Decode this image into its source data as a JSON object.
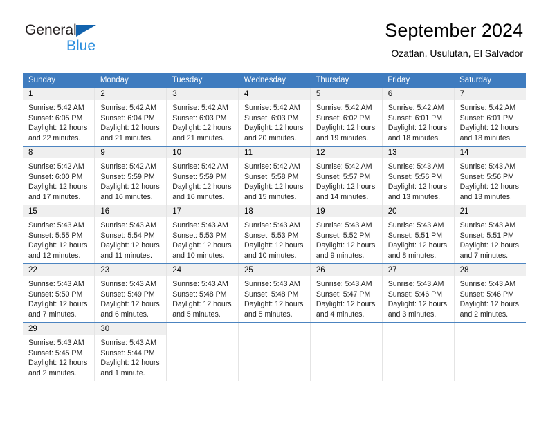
{
  "logo": {
    "word_one": "General",
    "word_two": "Blue",
    "sail_icon": "sail-triangle-icon",
    "colors": {
      "dark": "#231f20",
      "blue": "#2b8ede",
      "sail": "#1263ae"
    }
  },
  "header": {
    "title": "September 2024",
    "subtitle": "Ozatlan, Usulutan, El Salvador"
  },
  "theme": {
    "header_blue": "#3f7cbf",
    "row_divider": "#4c84c0",
    "daynum_bg": "#efefef",
    "cell_divider": "#e4e4e4"
  },
  "calendar": {
    "weekday_headers": [
      "Sunday",
      "Monday",
      "Tuesday",
      "Wednesday",
      "Thursday",
      "Friday",
      "Saturday"
    ],
    "weeks": [
      [
        {
          "day": "1",
          "sunrise": "Sunrise: 5:42 AM",
          "sunset": "Sunset: 6:05 PM",
          "daylight_line1": "Daylight: 12 hours",
          "daylight_line2": "and 22 minutes."
        },
        {
          "day": "2",
          "sunrise": "Sunrise: 5:42 AM",
          "sunset": "Sunset: 6:04 PM",
          "daylight_line1": "Daylight: 12 hours",
          "daylight_line2": "and 21 minutes."
        },
        {
          "day": "3",
          "sunrise": "Sunrise: 5:42 AM",
          "sunset": "Sunset: 6:03 PM",
          "daylight_line1": "Daylight: 12 hours",
          "daylight_line2": "and 21 minutes."
        },
        {
          "day": "4",
          "sunrise": "Sunrise: 5:42 AM",
          "sunset": "Sunset: 6:03 PM",
          "daylight_line1": "Daylight: 12 hours",
          "daylight_line2": "and 20 minutes."
        },
        {
          "day": "5",
          "sunrise": "Sunrise: 5:42 AM",
          "sunset": "Sunset: 6:02 PM",
          "daylight_line1": "Daylight: 12 hours",
          "daylight_line2": "and 19 minutes."
        },
        {
          "day": "6",
          "sunrise": "Sunrise: 5:42 AM",
          "sunset": "Sunset: 6:01 PM",
          "daylight_line1": "Daylight: 12 hours",
          "daylight_line2": "and 18 minutes."
        },
        {
          "day": "7",
          "sunrise": "Sunrise: 5:42 AM",
          "sunset": "Sunset: 6:01 PM",
          "daylight_line1": "Daylight: 12 hours",
          "daylight_line2": "and 18 minutes."
        }
      ],
      [
        {
          "day": "8",
          "sunrise": "Sunrise: 5:42 AM",
          "sunset": "Sunset: 6:00 PM",
          "daylight_line1": "Daylight: 12 hours",
          "daylight_line2": "and 17 minutes."
        },
        {
          "day": "9",
          "sunrise": "Sunrise: 5:42 AM",
          "sunset": "Sunset: 5:59 PM",
          "daylight_line1": "Daylight: 12 hours",
          "daylight_line2": "and 16 minutes."
        },
        {
          "day": "10",
          "sunrise": "Sunrise: 5:42 AM",
          "sunset": "Sunset: 5:59 PM",
          "daylight_line1": "Daylight: 12 hours",
          "daylight_line2": "and 16 minutes."
        },
        {
          "day": "11",
          "sunrise": "Sunrise: 5:42 AM",
          "sunset": "Sunset: 5:58 PM",
          "daylight_line1": "Daylight: 12 hours",
          "daylight_line2": "and 15 minutes."
        },
        {
          "day": "12",
          "sunrise": "Sunrise: 5:42 AM",
          "sunset": "Sunset: 5:57 PM",
          "daylight_line1": "Daylight: 12 hours",
          "daylight_line2": "and 14 minutes."
        },
        {
          "day": "13",
          "sunrise": "Sunrise: 5:43 AM",
          "sunset": "Sunset: 5:56 PM",
          "daylight_line1": "Daylight: 12 hours",
          "daylight_line2": "and 13 minutes."
        },
        {
          "day": "14",
          "sunrise": "Sunrise: 5:43 AM",
          "sunset": "Sunset: 5:56 PM",
          "daylight_line1": "Daylight: 12 hours",
          "daylight_line2": "and 13 minutes."
        }
      ],
      [
        {
          "day": "15",
          "sunrise": "Sunrise: 5:43 AM",
          "sunset": "Sunset: 5:55 PM",
          "daylight_line1": "Daylight: 12 hours",
          "daylight_line2": "and 12 minutes."
        },
        {
          "day": "16",
          "sunrise": "Sunrise: 5:43 AM",
          "sunset": "Sunset: 5:54 PM",
          "daylight_line1": "Daylight: 12 hours",
          "daylight_line2": "and 11 minutes."
        },
        {
          "day": "17",
          "sunrise": "Sunrise: 5:43 AM",
          "sunset": "Sunset: 5:53 PM",
          "daylight_line1": "Daylight: 12 hours",
          "daylight_line2": "and 10 minutes."
        },
        {
          "day": "18",
          "sunrise": "Sunrise: 5:43 AM",
          "sunset": "Sunset: 5:53 PM",
          "daylight_line1": "Daylight: 12 hours",
          "daylight_line2": "and 10 minutes."
        },
        {
          "day": "19",
          "sunrise": "Sunrise: 5:43 AM",
          "sunset": "Sunset: 5:52 PM",
          "daylight_line1": "Daylight: 12 hours",
          "daylight_line2": "and 9 minutes."
        },
        {
          "day": "20",
          "sunrise": "Sunrise: 5:43 AM",
          "sunset": "Sunset: 5:51 PM",
          "daylight_line1": "Daylight: 12 hours",
          "daylight_line2": "and 8 minutes."
        },
        {
          "day": "21",
          "sunrise": "Sunrise: 5:43 AM",
          "sunset": "Sunset: 5:51 PM",
          "daylight_line1": "Daylight: 12 hours",
          "daylight_line2": "and 7 minutes."
        }
      ],
      [
        {
          "day": "22",
          "sunrise": "Sunrise: 5:43 AM",
          "sunset": "Sunset: 5:50 PM",
          "daylight_line1": "Daylight: 12 hours",
          "daylight_line2": "and 7 minutes."
        },
        {
          "day": "23",
          "sunrise": "Sunrise: 5:43 AM",
          "sunset": "Sunset: 5:49 PM",
          "daylight_line1": "Daylight: 12 hours",
          "daylight_line2": "and 6 minutes."
        },
        {
          "day": "24",
          "sunrise": "Sunrise: 5:43 AM",
          "sunset": "Sunset: 5:48 PM",
          "daylight_line1": "Daylight: 12 hours",
          "daylight_line2": "and 5 minutes."
        },
        {
          "day": "25",
          "sunrise": "Sunrise: 5:43 AM",
          "sunset": "Sunset: 5:48 PM",
          "daylight_line1": "Daylight: 12 hours",
          "daylight_line2": "and 5 minutes."
        },
        {
          "day": "26",
          "sunrise": "Sunrise: 5:43 AM",
          "sunset": "Sunset: 5:47 PM",
          "daylight_line1": "Daylight: 12 hours",
          "daylight_line2": "and 4 minutes."
        },
        {
          "day": "27",
          "sunrise": "Sunrise: 5:43 AM",
          "sunset": "Sunset: 5:46 PM",
          "daylight_line1": "Daylight: 12 hours",
          "daylight_line2": "and 3 minutes."
        },
        {
          "day": "28",
          "sunrise": "Sunrise: 5:43 AM",
          "sunset": "Sunset: 5:46 PM",
          "daylight_line1": "Daylight: 12 hours",
          "daylight_line2": "and 2 minutes."
        }
      ],
      [
        {
          "day": "29",
          "sunrise": "Sunrise: 5:43 AM",
          "sunset": "Sunset: 5:45 PM",
          "daylight_line1": "Daylight: 12 hours",
          "daylight_line2": "and 2 minutes."
        },
        {
          "day": "30",
          "sunrise": "Sunrise: 5:43 AM",
          "sunset": "Sunset: 5:44 PM",
          "daylight_line1": "Daylight: 12 hours",
          "daylight_line2": "and 1 minute."
        },
        null,
        null,
        null,
        null,
        null
      ]
    ]
  }
}
